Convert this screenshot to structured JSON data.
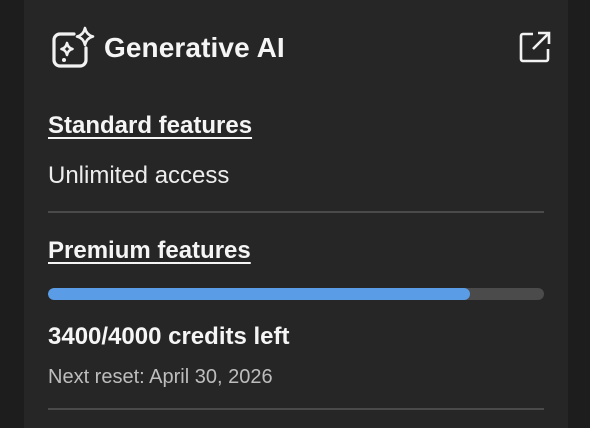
{
  "header": {
    "title": "Generative AI",
    "icon": "sparkle-ai-icon",
    "external_icon": "open-external-icon"
  },
  "standard": {
    "link_label": "Standard features",
    "access_text": "Unlimited access"
  },
  "premium": {
    "link_label": "Premium features",
    "credits_used_fraction": 0.85,
    "credits_text": "3400/4000 credits left",
    "reset_text": "Next reset: April 30, 2026"
  },
  "colors": {
    "background": "#262626",
    "progress_fill": "#5a9ce6",
    "progress_track": "#4b4b4b"
  }
}
